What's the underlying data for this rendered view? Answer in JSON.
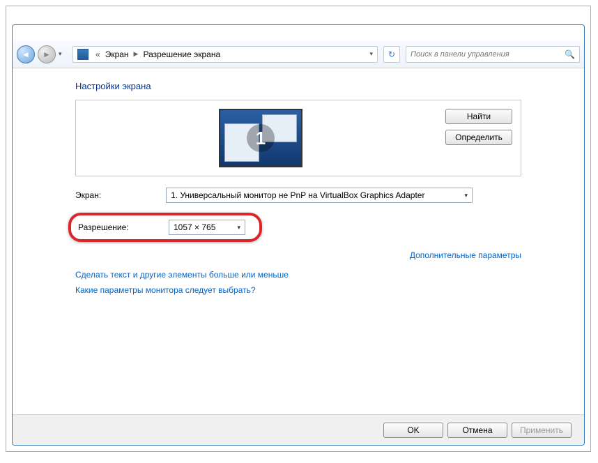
{
  "breadcrumb": {
    "root": "Экран",
    "current": "Разрешение экрана"
  },
  "search": {
    "placeholder": "Поиск в панели управления"
  },
  "heading": "Настройки экрана",
  "preview": {
    "monitor_number": "1",
    "find_btn": "Найти",
    "identify_btn": "Определить"
  },
  "form": {
    "screen_label": "Экран:",
    "screen_value": "1. Универсальный монитор не PnP на VirtualBox Graphics Adapter",
    "resolution_label": "Разрешение:",
    "resolution_value": "1057 × 765"
  },
  "links": {
    "advanced": "Дополнительные параметры",
    "text_size": "Сделать текст и другие элементы больше или меньше",
    "which_settings": "Какие параметры монитора следует выбрать?"
  },
  "buttons": {
    "ok": "OK",
    "cancel": "Отмена",
    "apply": "Применить"
  }
}
